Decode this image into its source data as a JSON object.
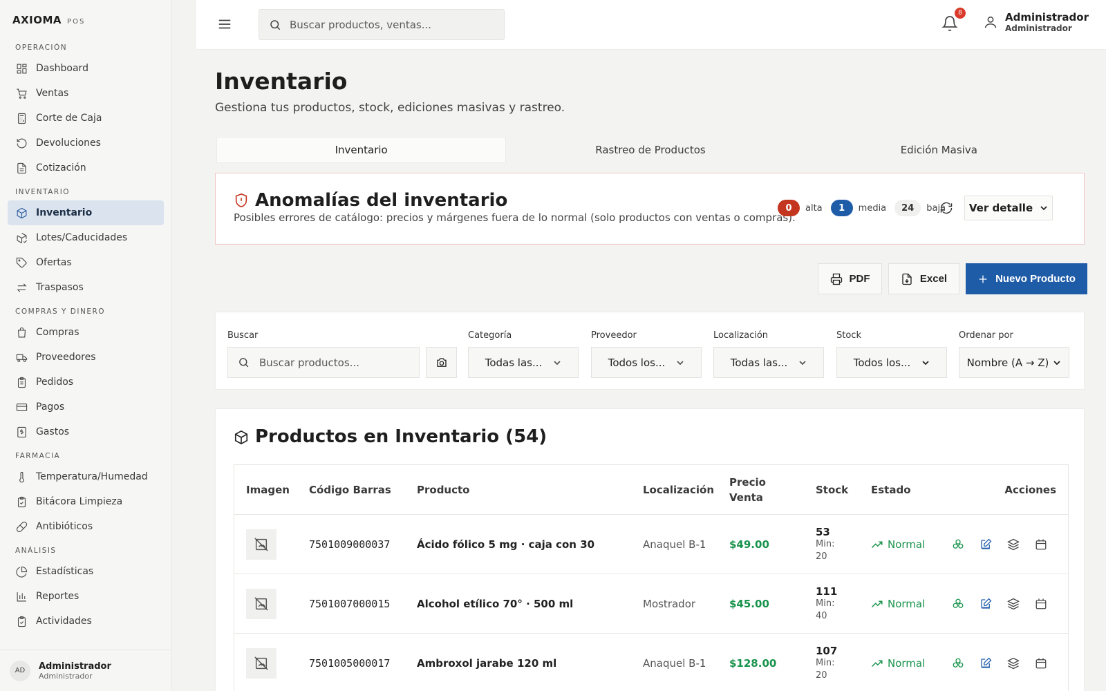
{
  "brand": {
    "name": "AXIOMA",
    "sub": "POS"
  },
  "sidebar": {
    "sections": [
      {
        "title": "OPERACIÓN",
        "items": [
          "Dashboard",
          "Ventas",
          "Corte de Caja",
          "Devoluciones",
          "Cotización"
        ]
      },
      {
        "title": "INVENTARIO",
        "items": [
          "Inventario",
          "Lotes/Caducidades",
          "Ofertas",
          "Traspasos"
        ]
      },
      {
        "title": "COMPRAS Y DINERO",
        "items": [
          "Compras",
          "Proveedores",
          "Pedidos",
          "Pagos",
          "Gastos"
        ]
      },
      {
        "title": "FARMACIA",
        "items": [
          "Temperatura/Humedad",
          "Bitácora Limpieza",
          "Antibióticos"
        ]
      },
      {
        "title": "ANÁLISIS",
        "items": [
          "Estadísticas",
          "Reportes",
          "Actividades"
        ]
      }
    ],
    "active": "Inventario",
    "user": {
      "initials": "AD",
      "name": "Administrador",
      "role": "Administrador"
    }
  },
  "topbar": {
    "search_placeholder": "Buscar productos, ventas...",
    "notification_count": "8",
    "user_name": "Administrador",
    "user_role": "Administrador"
  },
  "page": {
    "title": "Inventario",
    "subtitle": "Gestiona tus productos, stock, ediciones masivas y rastreo."
  },
  "tabs": [
    "Inventario",
    "Rastreo de Productos",
    "Edición Masiva"
  ],
  "anomaly": {
    "title": "Anomalías del inventario",
    "description": "Posibles errores de catálogo: precios y márgenes fuera de lo normal (solo productos con ventas o compras).",
    "high_count": "0",
    "high_label": "alta",
    "medium_count": "1",
    "medium_label": "media",
    "low_count": "24",
    "low_label": "baja",
    "detail_label": "Ver detalle"
  },
  "toolbar": {
    "pdf": "PDF",
    "excel": "Excel",
    "new_product": "Nuevo Producto"
  },
  "filters": {
    "search_label": "Buscar",
    "search_placeholder": "Buscar productos...",
    "category_label": "Categoría",
    "category_value": "Todas las...",
    "supplier_label": "Proveedor",
    "supplier_value": "Todos los...",
    "location_label": "Localización",
    "location_value": "Todas las...",
    "stock_label": "Stock",
    "stock_value": "Todos los...",
    "sort_label": "Ordenar por",
    "sort_value": "Nombre (A → Z)"
  },
  "products": {
    "title": "Productos en Inventario (54)",
    "columns": {
      "image": "Imagen",
      "barcode": "Código Barras",
      "product": "Producto",
      "location": "Localización",
      "price_line1": "Precio",
      "price_line2": "Venta",
      "stock": "Stock",
      "status": "Estado",
      "actions": "Acciones"
    },
    "rows": [
      {
        "barcode": "7501009000037",
        "name": "Ácido fólico 5 mg · caja con 30",
        "location": "Anaquel B-1",
        "price": "$49.00",
        "stock": "53",
        "min": "Min: 20",
        "status": "Normal"
      },
      {
        "barcode": "7501007000015",
        "name": "Alcohol etílico 70° · 500 ml",
        "location": "Mostrador",
        "price": "$45.00",
        "stock": "111",
        "min": "Min: 40",
        "status": "Normal"
      },
      {
        "barcode": "7501005000017",
        "name": "Ambroxol jarabe 120 ml",
        "location": "Anaquel B-1",
        "price": "$128.00",
        "stock": "107",
        "min": "Min: 20",
        "status": "Normal"
      }
    ]
  },
  "colors": {
    "accent": "#1f5ca8",
    "success": "#17924a",
    "danger": "#c4351f",
    "active_nav": "#dbe4ee"
  }
}
